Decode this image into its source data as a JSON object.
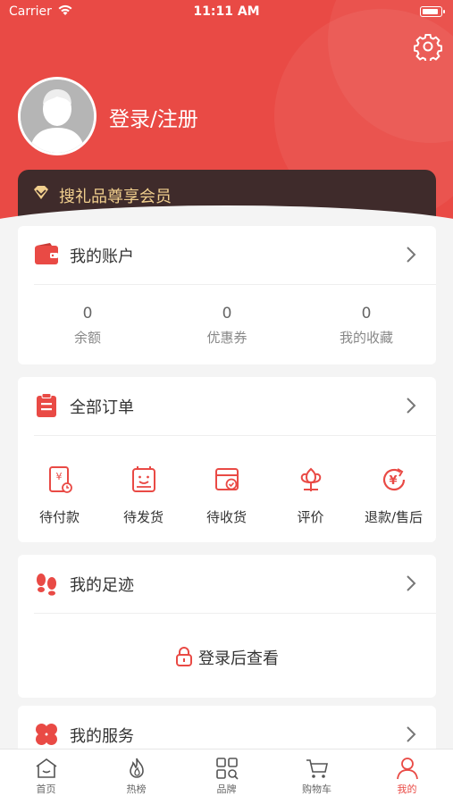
{
  "status_bar": {
    "carrier": "Carrier",
    "time": "11:11 AM"
  },
  "header": {
    "login_text": "登录/注册",
    "vip_text": "搜礼品尊享会员",
    "settings_icon": "gear-icon",
    "accent": "#e94a45"
  },
  "account": {
    "title": "我的账户",
    "stats": [
      {
        "value": "0",
        "label": "余额"
      },
      {
        "value": "0",
        "label": "优惠券"
      },
      {
        "value": "0",
        "label": "我的收藏"
      }
    ]
  },
  "orders": {
    "title": "全部订单",
    "items": [
      {
        "label": "待付款",
        "icon": "pending-payment-icon"
      },
      {
        "label": "待发货",
        "icon": "pending-shipment-icon"
      },
      {
        "label": "待收货",
        "icon": "pending-receipt-icon"
      },
      {
        "label": "评价",
        "icon": "review-icon"
      },
      {
        "label": "退款/售后",
        "icon": "refund-icon"
      }
    ]
  },
  "footprint": {
    "title": "我的足迹",
    "hint": "登录后查看"
  },
  "services": {
    "title": "我的服务"
  },
  "tabbar": {
    "items": [
      {
        "label": "首页",
        "icon": "home-icon"
      },
      {
        "label": "热榜",
        "icon": "flame-icon"
      },
      {
        "label": "品牌",
        "icon": "brand-grid-icon"
      },
      {
        "label": "购物车",
        "icon": "cart-icon"
      },
      {
        "label": "我的",
        "icon": "person-icon"
      }
    ],
    "active_index": 4
  }
}
